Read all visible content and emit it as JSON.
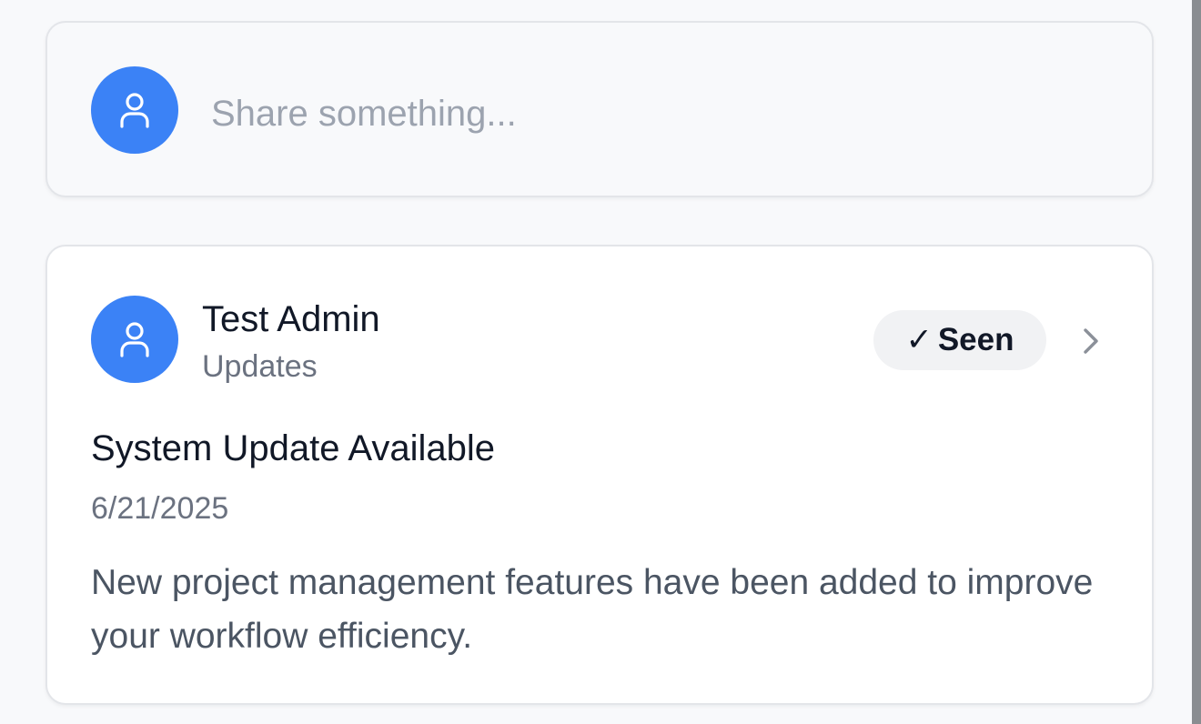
{
  "composer": {
    "placeholder": "Share something...",
    "avatar_icon": "user-icon"
  },
  "post": {
    "author_name": "Test Admin",
    "group": "Updates",
    "status_check": "✓",
    "status_label": "Seen",
    "title": "System Update Available",
    "date": "6/21/2025",
    "body": "New project management features have been added to improve your workflow efficiency.",
    "avatar_icon": "user-icon",
    "expand_icon": "chevron-right-icon"
  },
  "colors": {
    "avatar": "#3b82f6",
    "background": "#f8f9fb",
    "card": "#ffffff",
    "badge": "#f1f2f4"
  }
}
